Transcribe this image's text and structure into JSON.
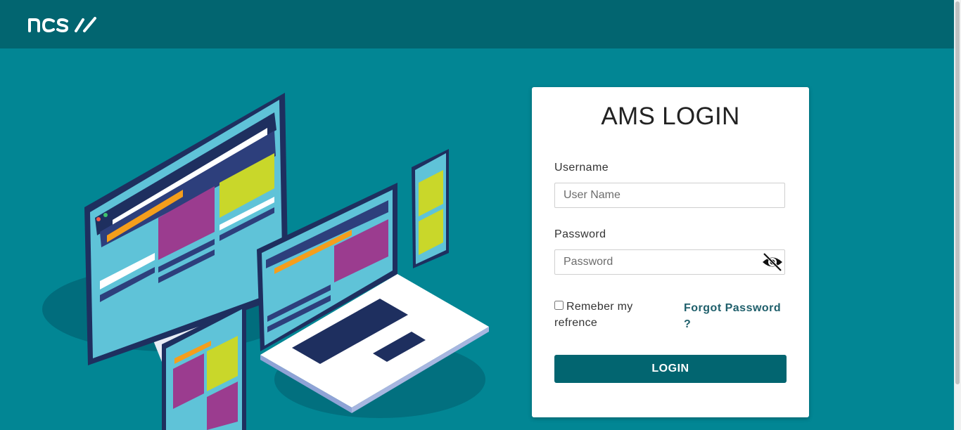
{
  "header": {
    "logo_text": "ncs//",
    "logo_icon": "ncs-logo-icon",
    "background": "#026570"
  },
  "page": {
    "background": "#028694"
  },
  "login": {
    "title": "AMS LOGIN",
    "username_label": "Username",
    "username_placeholder": "User Name",
    "username_value": "",
    "password_label": "Password",
    "password_placeholder": "Password",
    "password_value": "",
    "toggle_icon": "eye-slash-icon",
    "remember_label": "Remeber my refrence",
    "remember_checked": false,
    "forgot_label": "Forgot Password ?",
    "login_button": "LOGIN",
    "accent_color": "#026570"
  },
  "illustration": {
    "icon": "devices-illustration"
  }
}
